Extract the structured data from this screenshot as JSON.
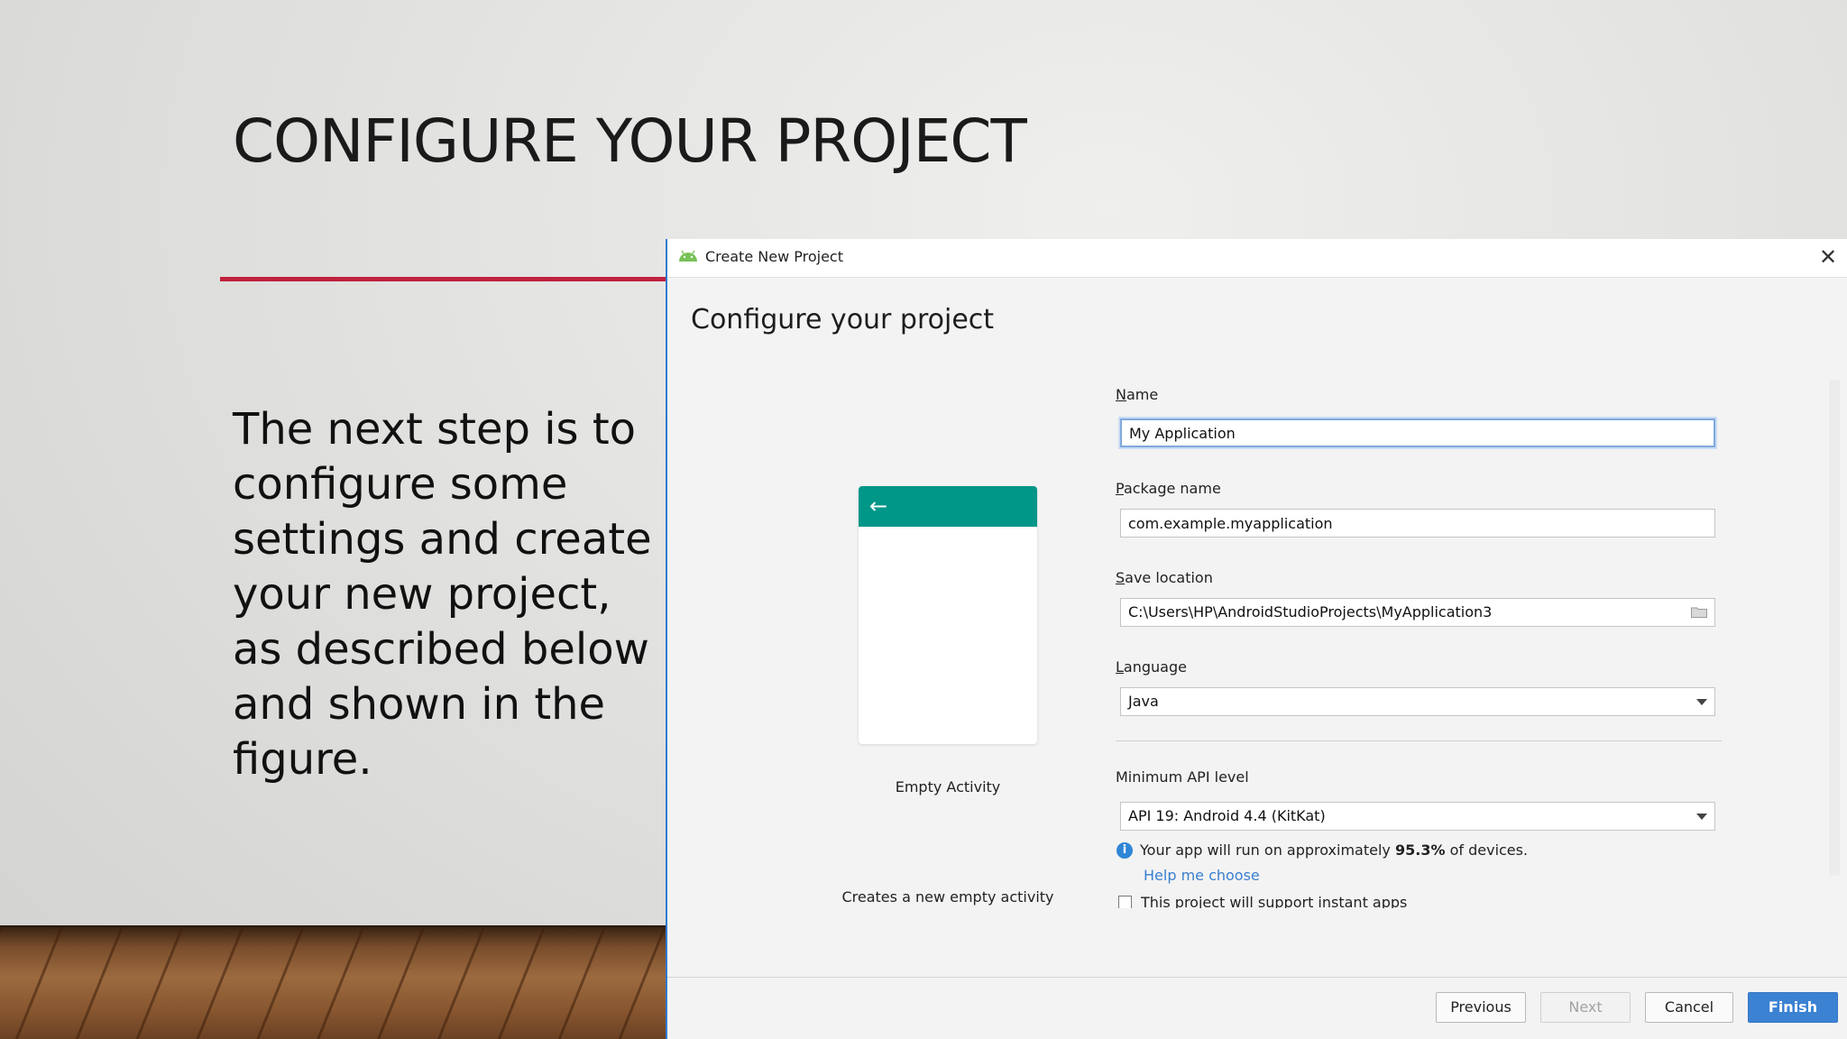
{
  "slide": {
    "title": "CONFIGURE YOUR PROJECT",
    "body": "The next step is to configure some settings and create your new project, as described below and shown in the figure.",
    "accent_color": "#c0213d"
  },
  "dialog": {
    "window_title": "Create New Project",
    "heading": "Configure your project",
    "template": {
      "label": "Empty Activity",
      "description": "Creates a new empty activity",
      "toolbar_color": "#009688"
    },
    "fields": {
      "name": {
        "label_key": "N",
        "label_rest": "ame",
        "value": "My Application"
      },
      "package": {
        "label_key": "P",
        "label_rest": "ackage name",
        "value": "com.example.myapplication"
      },
      "save_location": {
        "label_key": "S",
        "label_rest": "ave location",
        "value": "C:\\Users\\HP\\AndroidStudioProjects\\MyApplication3",
        "icon": "folder-icon"
      },
      "language": {
        "label_key": "L",
        "label_rest": "anguage",
        "value": "Java"
      },
      "min_api": {
        "label": "Minimum API level",
        "value": "API 19: Android 4.4 (KitKat)"
      }
    },
    "info": {
      "prefix": "Your app will run on approximately ",
      "percent": "95.3%",
      "suffix": " of devices."
    },
    "help_link": "Help me choose",
    "instant_apps_label": "This project will support instant apps",
    "buttons": {
      "previous": "Previous",
      "next": "Next",
      "cancel": "Cancel",
      "finish": "Finish"
    },
    "accent_color": "#3b82d3"
  }
}
